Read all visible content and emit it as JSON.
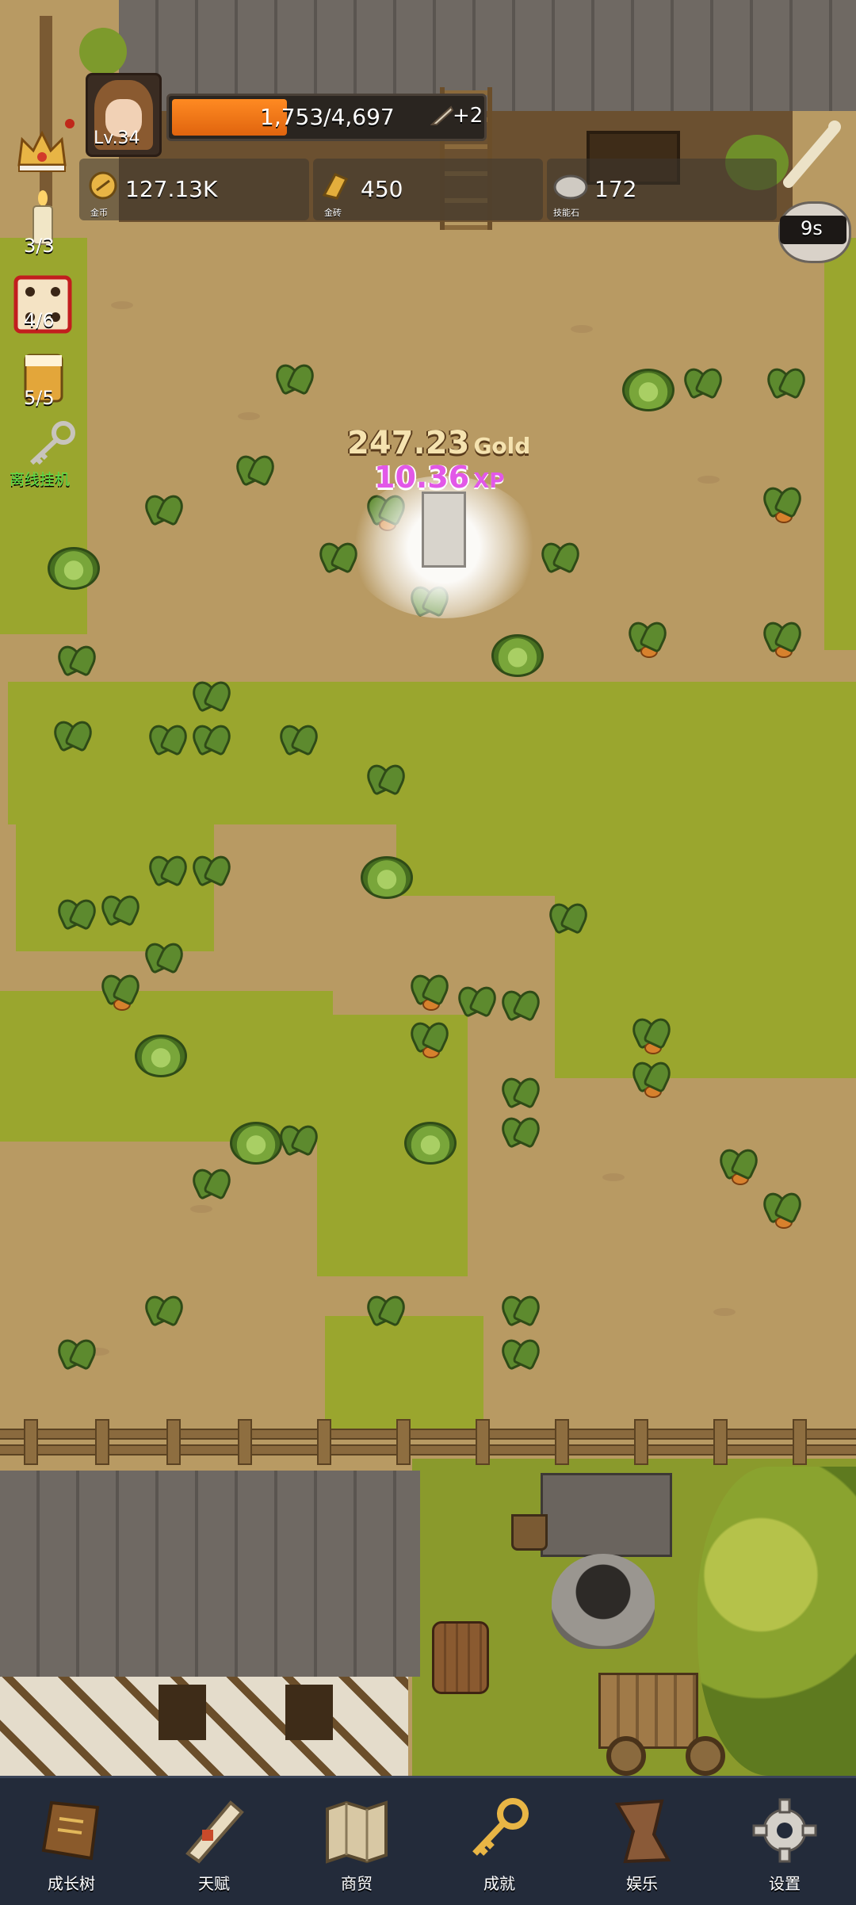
{
  "player": {
    "level": "Lv.34",
    "xp_text": "1,753/4,697",
    "xp_bonus": "+2",
    "xp_progress": 0.373
  },
  "resources": [
    {
      "name_label": "金币",
      "value": "127.13K",
      "icon": "gold-coin-icon"
    },
    {
      "name_label": "金砖",
      "value": "450",
      "icon": "gold-bar-icon"
    },
    {
      "name_label": "技能石",
      "value": "172",
      "icon": "skill-stone-icon"
    }
  ],
  "left_stack": [
    {
      "icon": "crown-icon",
      "label": ""
    },
    {
      "icon": "candle-icon",
      "label": "3/3"
    },
    {
      "icon": "dice-icon",
      "label": "4/6"
    },
    {
      "icon": "beer-icon",
      "label": "5/5"
    },
    {
      "icon": "key-icon",
      "label": "离线挂机"
    }
  ],
  "timer": {
    "label": "9s"
  },
  "popup": {
    "gold_value": "247.23",
    "gold_unit": "Gold",
    "xp_value": "10.36",
    "xp_unit": "XP"
  },
  "nav": [
    {
      "label": "成长树",
      "icon": "book-icon"
    },
    {
      "label": "天赋",
      "icon": "scroll-icon"
    },
    {
      "label": "商贸",
      "icon": "map-icon"
    },
    {
      "label": "成就",
      "icon": "golden-key-icon"
    },
    {
      "label": "娱乐",
      "icon": "parchment-icon"
    },
    {
      "label": "设置",
      "icon": "gear-icon"
    }
  ],
  "colors": {
    "xp_bar": "#f07a18",
    "xp_popup": "#d84be0",
    "gold_popup": "#f5e3b0",
    "nav_bg": "#232b3a",
    "offline_label": "#58e04a"
  }
}
